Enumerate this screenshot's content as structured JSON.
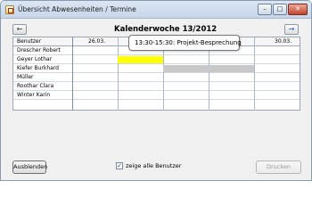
{
  "window": {
    "title": "Übersicht Abwesenheiten / Termine",
    "controls": {
      "minimize": "–",
      "maximize": "□",
      "close": "✕"
    }
  },
  "navigation": {
    "prev_arrow": "←",
    "next_arrow": "→",
    "week_title": "Kalenderwoche 13/2012"
  },
  "table": {
    "header_label": "Benutzer",
    "visible_dates": {
      "first": "26.03.",
      "last": "30.03."
    },
    "users": [
      {
        "name": "Drescher Robert"
      },
      {
        "name": "Geyer Lothar"
      },
      {
        "name": "Kiefer Burkhard"
      },
      {
        "name": "Müller"
      },
      {
        "name": "Roothar Clara"
      },
      {
        "name": "Winter Karin"
      }
    ]
  },
  "appointments": [
    {
      "user": "Geyer Lothar",
      "color": "#ffff00"
    },
    {
      "user": "Kiefer Burkhard",
      "color": "#c8c8c8"
    }
  ],
  "tooltip": {
    "text": "13:30-15:30: Projekt-Besprechung"
  },
  "footer": {
    "hide_button": "Ausblenden",
    "show_all_users": {
      "label": "zeige alle Benutzer",
      "checked": true,
      "mark": "✓"
    },
    "print_button": "Drucken"
  }
}
